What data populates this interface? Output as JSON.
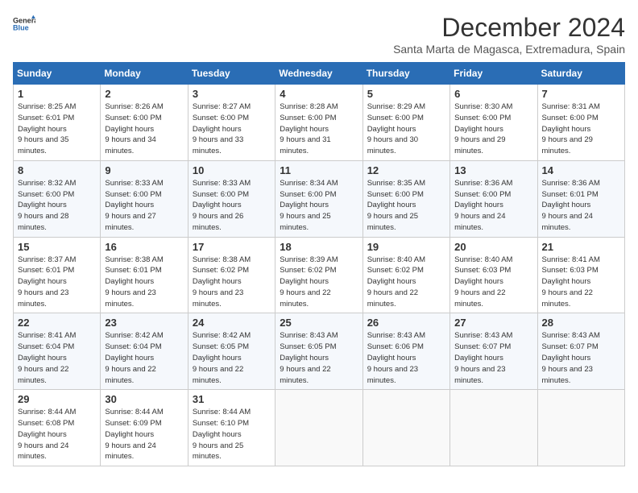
{
  "logo": {
    "line1": "General",
    "line2": "Blue"
  },
  "title": "December 2024",
  "location": "Santa Marta de Magasca, Extremadura, Spain",
  "weekdays": [
    "Sunday",
    "Monday",
    "Tuesday",
    "Wednesday",
    "Thursday",
    "Friday",
    "Saturday"
  ],
  "weeks": [
    [
      {
        "day": "1",
        "sunrise": "8:25 AM",
        "sunset": "6:01 PM",
        "daylight": "9 hours and 35 minutes."
      },
      {
        "day": "2",
        "sunrise": "8:26 AM",
        "sunset": "6:00 PM",
        "daylight": "9 hours and 34 minutes."
      },
      {
        "day": "3",
        "sunrise": "8:27 AM",
        "sunset": "6:00 PM",
        "daylight": "9 hours and 33 minutes."
      },
      {
        "day": "4",
        "sunrise": "8:28 AM",
        "sunset": "6:00 PM",
        "daylight": "9 hours and 31 minutes."
      },
      {
        "day": "5",
        "sunrise": "8:29 AM",
        "sunset": "6:00 PM",
        "daylight": "9 hours and 30 minutes."
      },
      {
        "day": "6",
        "sunrise": "8:30 AM",
        "sunset": "6:00 PM",
        "daylight": "9 hours and 29 minutes."
      },
      {
        "day": "7",
        "sunrise": "8:31 AM",
        "sunset": "6:00 PM",
        "daylight": "9 hours and 29 minutes."
      }
    ],
    [
      {
        "day": "8",
        "sunrise": "8:32 AM",
        "sunset": "6:00 PM",
        "daylight": "9 hours and 28 minutes."
      },
      {
        "day": "9",
        "sunrise": "8:33 AM",
        "sunset": "6:00 PM",
        "daylight": "9 hours and 27 minutes."
      },
      {
        "day": "10",
        "sunrise": "8:33 AM",
        "sunset": "6:00 PM",
        "daylight": "9 hours and 26 minutes."
      },
      {
        "day": "11",
        "sunrise": "8:34 AM",
        "sunset": "6:00 PM",
        "daylight": "9 hours and 25 minutes."
      },
      {
        "day": "12",
        "sunrise": "8:35 AM",
        "sunset": "6:00 PM",
        "daylight": "9 hours and 25 minutes."
      },
      {
        "day": "13",
        "sunrise": "8:36 AM",
        "sunset": "6:00 PM",
        "daylight": "9 hours and 24 minutes."
      },
      {
        "day": "14",
        "sunrise": "8:36 AM",
        "sunset": "6:01 PM",
        "daylight": "9 hours and 24 minutes."
      }
    ],
    [
      {
        "day": "15",
        "sunrise": "8:37 AM",
        "sunset": "6:01 PM",
        "daylight": "9 hours and 23 minutes."
      },
      {
        "day": "16",
        "sunrise": "8:38 AM",
        "sunset": "6:01 PM",
        "daylight": "9 hours and 23 minutes."
      },
      {
        "day": "17",
        "sunrise": "8:38 AM",
        "sunset": "6:02 PM",
        "daylight": "9 hours and 23 minutes."
      },
      {
        "day": "18",
        "sunrise": "8:39 AM",
        "sunset": "6:02 PM",
        "daylight": "9 hours and 22 minutes."
      },
      {
        "day": "19",
        "sunrise": "8:40 AM",
        "sunset": "6:02 PM",
        "daylight": "9 hours and 22 minutes."
      },
      {
        "day": "20",
        "sunrise": "8:40 AM",
        "sunset": "6:03 PM",
        "daylight": "9 hours and 22 minutes."
      },
      {
        "day": "21",
        "sunrise": "8:41 AM",
        "sunset": "6:03 PM",
        "daylight": "9 hours and 22 minutes."
      }
    ],
    [
      {
        "day": "22",
        "sunrise": "8:41 AM",
        "sunset": "6:04 PM",
        "daylight": "9 hours and 22 minutes."
      },
      {
        "day": "23",
        "sunrise": "8:42 AM",
        "sunset": "6:04 PM",
        "daylight": "9 hours and 22 minutes."
      },
      {
        "day": "24",
        "sunrise": "8:42 AM",
        "sunset": "6:05 PM",
        "daylight": "9 hours and 22 minutes."
      },
      {
        "day": "25",
        "sunrise": "8:43 AM",
        "sunset": "6:05 PM",
        "daylight": "9 hours and 22 minutes."
      },
      {
        "day": "26",
        "sunrise": "8:43 AM",
        "sunset": "6:06 PM",
        "daylight": "9 hours and 23 minutes."
      },
      {
        "day": "27",
        "sunrise": "8:43 AM",
        "sunset": "6:07 PM",
        "daylight": "9 hours and 23 minutes."
      },
      {
        "day": "28",
        "sunrise": "8:43 AM",
        "sunset": "6:07 PM",
        "daylight": "9 hours and 23 minutes."
      }
    ],
    [
      {
        "day": "29",
        "sunrise": "8:44 AM",
        "sunset": "6:08 PM",
        "daylight": "9 hours and 24 minutes."
      },
      {
        "day": "30",
        "sunrise": "8:44 AM",
        "sunset": "6:09 PM",
        "daylight": "9 hours and 24 minutes."
      },
      {
        "day": "31",
        "sunrise": "8:44 AM",
        "sunset": "6:10 PM",
        "daylight": "9 hours and 25 minutes."
      },
      null,
      null,
      null,
      null
    ]
  ],
  "labels": {
    "sunrise": "Sunrise:",
    "sunset": "Sunset:",
    "daylight": "Daylight:"
  }
}
